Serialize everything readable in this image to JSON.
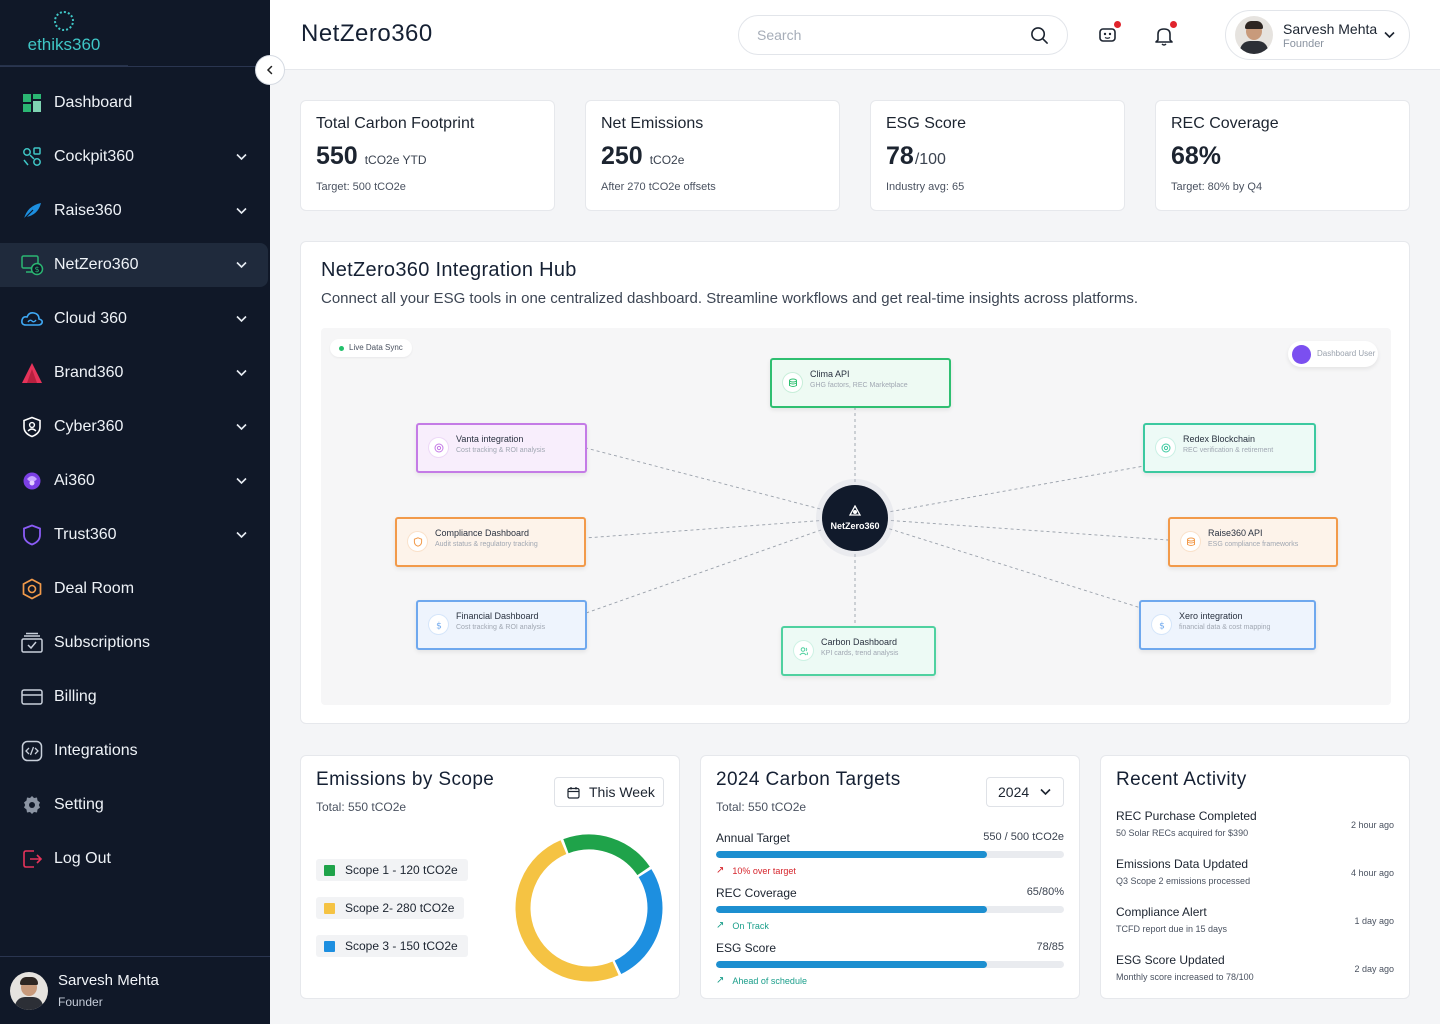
{
  "brand": {
    "name": "ethiks360",
    "color": "#3fc6c6"
  },
  "sidebar": {
    "items": [
      {
        "label": "Dashboard",
        "icon": "grid-icon",
        "has_chevron": false
      },
      {
        "label": "Cockpit360",
        "icon": "cockpit-icon",
        "has_chevron": true
      },
      {
        "label": "Raise360",
        "icon": "feather-icon",
        "has_chevron": true
      },
      {
        "label": "NetZero360",
        "icon": "money-screen-icon",
        "has_chevron": true,
        "active": true
      },
      {
        "label": "Cloud 360",
        "icon": "cloud-icon",
        "has_chevron": true
      },
      {
        "label": "Brand360",
        "icon": "brand-icon",
        "has_chevron": true
      },
      {
        "label": "Cyber360",
        "icon": "shield-user-icon",
        "has_chevron": true
      },
      {
        "label": "Ai360",
        "icon": "ai-icon",
        "has_chevron": true
      },
      {
        "label": "Trust360",
        "icon": "shield-icon",
        "has_chevron": true
      },
      {
        "label": "Deal Room",
        "icon": "hexagon-icon",
        "has_chevron": false
      },
      {
        "label": "Subscriptions",
        "icon": "subscriptions-icon",
        "has_chevron": false
      },
      {
        "label": "Billing",
        "icon": "credit-card-icon",
        "has_chevron": false
      },
      {
        "label": "Integrations",
        "icon": "code-icon",
        "has_chevron": false
      },
      {
        "label": "Setting",
        "icon": "gear-icon",
        "has_chevron": false
      },
      {
        "label": "Log Out",
        "icon": "logout-icon",
        "has_chevron": false
      }
    ],
    "footer": {
      "name": "Sarvesh Mehta",
      "role": "Founder"
    }
  },
  "header": {
    "title": "NetZero360",
    "search_placeholder": "Search",
    "user": {
      "name": "Sarvesh Mehta",
      "role": "Founder"
    }
  },
  "kpis": [
    {
      "title": "Total Carbon Footprint",
      "value": "550",
      "unit": "tCO2e YTD",
      "sub": "Target: 500 tCO2e"
    },
    {
      "title": "Net Emissions",
      "value": "250",
      "unit": "tCO2e",
      "sub": "After 270 tCO2e offsets"
    },
    {
      "title": "ESG Score",
      "value": "78",
      "unit": "/100",
      "sub": "Industry avg: 65"
    },
    {
      "title": "REC Coverage",
      "value": "68%",
      "unit": "",
      "sub": "Target: 80% by Q4"
    }
  ],
  "hub": {
    "title": "NetZero360 Integration Hub",
    "description": "Connect all your ESG tools in one centralized dashboard. Streamline workflows and get real-time insights across platforms.",
    "live_label": "Live Data Sync",
    "dashboard_user_label": "Dashboard User",
    "center_label": "NetZero360",
    "nodes": [
      {
        "title": "Clima API",
        "sub": "GHG factors, REC Marketplace",
        "color": "#2fbf71",
        "bg": "#eefaf3",
        "icon": "database-icon"
      },
      {
        "title": "Vanta integration",
        "sub": "Cost tracking & ROI analysis",
        "color": "#c47be6",
        "bg": "#f8eefc",
        "icon": "target-icon"
      },
      {
        "title": "Redex Blockchain",
        "sub": "REC verification & retirement",
        "color": "#3cc9a0",
        "bg": "#edfaf6",
        "icon": "target-icon"
      },
      {
        "title": "Compliance Dashboard",
        "sub": "Audit status & regulatory tracking",
        "color": "#f29a4a",
        "bg": "#fdf3ea",
        "icon": "shield-icon"
      },
      {
        "title": "Raise360 API",
        "sub": "ESG compliance frameworks",
        "color": "#f29a4a",
        "bg": "#fdf3ea",
        "icon": "database-icon"
      },
      {
        "title": "Financial Dashboard",
        "sub": "Cost tracking & ROI analysis",
        "color": "#6fa8ee",
        "bg": "#eef4fd",
        "icon": "dollar-icon"
      },
      {
        "title": "Xero integration",
        "sub": "financial data & cost mapping",
        "color": "#6fa8ee",
        "bg": "#eef4fd",
        "icon": "dollar-icon"
      },
      {
        "title": "Carbon Dashboard",
        "sub": "KPI cards, trend analysis",
        "color": "#4fd1a0",
        "bg": "#edfaf5",
        "icon": "users-icon"
      }
    ]
  },
  "emissions": {
    "title": "Emissions by Scope",
    "total": "Total: 550 tCO2e",
    "period_button": "This Week",
    "chart_data": {
      "type": "pie",
      "categories": [
        "Scope 1",
        "Scope 2",
        "Scope 3"
      ],
      "values": [
        120,
        280,
        150
      ],
      "colors": [
        "#1fa34a",
        "#f5c343",
        "#1d8fe0"
      ]
    },
    "legend": [
      {
        "label": "Scope 1 - 120 tCO2e",
        "color": "#1fa34a"
      },
      {
        "label": "Scope 2- 280 tCO2e",
        "color": "#f5c343"
      },
      {
        "label": "Scope 3 - 150 tCO2e",
        "color": "#1d8fe0"
      }
    ]
  },
  "targets": {
    "title": "2024 Carbon Targets",
    "total": "Total: 550 tCO2e",
    "year": "2024",
    "items": [
      {
        "label": "Annual Target",
        "value": "550 / 500 tCO2e",
        "progress": 0.78,
        "note": "10% over target",
        "note_color": "#d6262d",
        "arrow": "↗"
      },
      {
        "label": "REC Coverage",
        "value": "65/80%",
        "progress": 0.78,
        "note": "On Track",
        "note_color": "#1a9e8a",
        "arrow": "↗"
      },
      {
        "label": "ESG Score",
        "value": "78/85",
        "progress": 0.78,
        "note": "Ahead of schedule",
        "note_color": "#1a9e8a",
        "arrow": "↗"
      }
    ]
  },
  "activity": {
    "title": "Recent Activity",
    "items": [
      {
        "title": "REC Purchase Completed",
        "desc": "50 Solar RECs acquired for $390",
        "time": "2 hour ago"
      },
      {
        "title": "Emissions Data Updated",
        "desc": "Q3 Scope 2 emissions processed",
        "time": "4 hour ago"
      },
      {
        "title": "Compliance Alert",
        "desc": "TCFD report due in 15 days",
        "time": "1 day ago"
      },
      {
        "title": "ESG Score Updated",
        "desc": "Monthly score increased to 78/100",
        "time": "2 day ago"
      }
    ]
  }
}
